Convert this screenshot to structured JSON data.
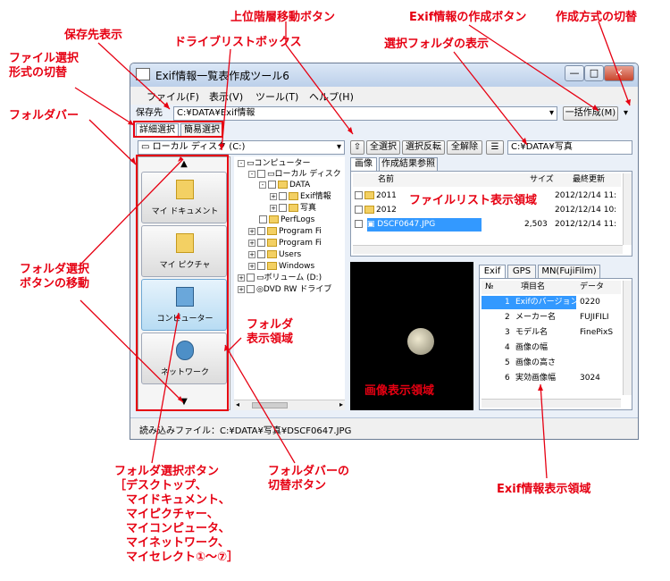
{
  "annotations": {
    "save_location": "保存先表示",
    "file_format_switch": "ファイル選択\n形式の切替",
    "folder_bar": "フォルダバー",
    "drive_listbox": "ドライブリストボックス",
    "up_level": "上位階層移動ボタン",
    "exif_create": "Exif情報の作成ボタン",
    "create_method": "作成方式の切替",
    "selected_folder": "選択フォルダの表示",
    "file_list_area": "ファイルリスト表示領域",
    "folder_btn_move": "フォルダ選択\nボタンの移動",
    "folder_display": "フォルダ\n表示領域",
    "image_display": "画像表示領域",
    "folder_select_btn": "フォルダ選択ボタン\n［デスクトップ、\n　マイドキュメント、\n　マイピクチャー、\n　マイコンピュータ、\n　マイネットワーク、\n　マイセレクト①～⑦］",
    "folder_bar_switch": "フォルダバーの\n切替ボタン",
    "exif_display": "Exif情報表示領域"
  },
  "window": {
    "title": "Exif情報一覧表作成ツール6",
    "min": "—",
    "max": "□",
    "close": "✕",
    "menu": [
      "ファイル(F)",
      "表示(V)",
      "ツール(T)",
      "ヘルプ(H)"
    ],
    "save_label": "保存先",
    "save_path": "C:¥DATA¥Exif情報",
    "create_btn": "一括作成(M)",
    "tab_detail": "詳細選択",
    "tab_simple": "簡易選択",
    "drive": "ローカル ディスク (C:)",
    "toolbar": {
      "select_all": "全選択",
      "invert": "選択反転",
      "deselect": "全解除"
    },
    "folder_path": "C:¥DATA¥写真",
    "file_tabs": [
      "画像",
      "作成結果参照"
    ],
    "file_headers": [
      "名前",
      "サイズ",
      "最終更新"
    ],
    "files": [
      {
        "name": "2011",
        "size": "",
        "date": "2012/12/14 11:"
      },
      {
        "name": "2012",
        "size": "",
        "date": "2012/12/14 10:"
      },
      {
        "name": "DSCF0647.JPG",
        "size": "2,503",
        "date": "2012/12/14 11:"
      }
    ],
    "folder_buttons": [
      "マイ ドキュメント",
      "マイ ピクチャ",
      "コンピューター",
      "ネットワーク"
    ],
    "up_arrow": "▲",
    "down_arrow": "▼",
    "tree": [
      "コンピューター",
      "ローカル ディスク",
      "DATA",
      "Exif情報",
      "写真",
      "PerfLogs",
      "Program Fi",
      "Program Fi",
      "Users",
      "Windows",
      "ボリューム (D:)",
      "DVD RW ドライブ"
    ],
    "exif_tabs": [
      "Exif",
      "GPS",
      "MN(FujiFilm)"
    ],
    "exif_headers": [
      "№",
      "項目名",
      "データ"
    ],
    "exif_rows": [
      {
        "no": "1",
        "name": "Exifのバージョン",
        "data": "0220"
      },
      {
        "no": "2",
        "name": "メーカー名",
        "data": "FUJIFILI"
      },
      {
        "no": "3",
        "name": "モデル名",
        "data": "FinePixS"
      },
      {
        "no": "4",
        "name": "画像の幅",
        "data": ""
      },
      {
        "no": "5",
        "name": "画像の高さ",
        "data": ""
      },
      {
        "no": "6",
        "name": "実効画像幅",
        "data": "3024"
      }
    ],
    "status": "読み込みファイル：C:¥DATA¥写真¥DSCF0647.JPG"
  },
  "colors": {
    "accent_red": "#e60012",
    "selection": "#3399ff"
  }
}
